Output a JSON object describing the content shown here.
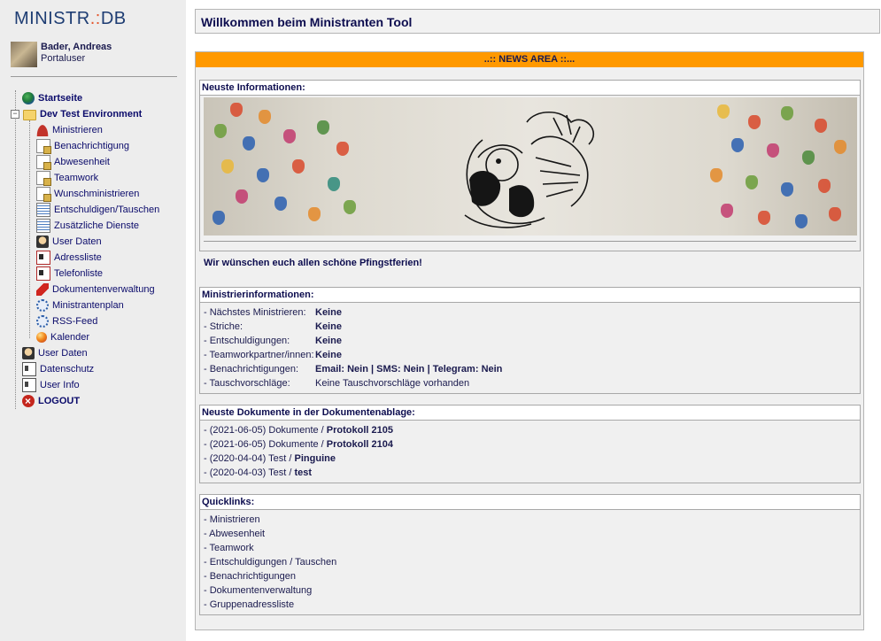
{
  "app": {
    "logo_main": "MINISTR",
    "logo_sep": ".:",
    "logo_end": "DB"
  },
  "user": {
    "name": "Bader, Andreas",
    "role": "Portaluser"
  },
  "nav": {
    "startseite": "Startseite",
    "group": "Dev Test Environment",
    "group_items": [
      "Ministrieren",
      "Benachrichtigung",
      "Abwesenheit",
      "Teamwork",
      "Wunschministrieren",
      "Entschuldigen/Tauschen",
      "Zusätzliche Dienste",
      "User Daten",
      "Adressliste",
      "Telefonliste",
      "Dokumentenverwaltung",
      "Ministrantenplan",
      "RSS-Feed",
      "Kalender"
    ],
    "bottom_items": [
      "User Daten",
      "Datenschutz",
      "User Info",
      "LOGOUT"
    ]
  },
  "page": {
    "title": "Willkommen beim Ministranten Tool",
    "news_header": "..:: NEWS AREA ::..."
  },
  "news": {
    "heading": "Neuste Informationen:",
    "text": "Wir wünschen euch allen schöne Pfingstferien!"
  },
  "info": {
    "heading": "Ministrierinformationen:",
    "rows": [
      {
        "label": "- Nächstes Ministrieren:",
        "value": "Keine"
      },
      {
        "label": "- Striche:",
        "value": "Keine"
      },
      {
        "label": "- Entschuldigungen:",
        "value": "Keine"
      },
      {
        "label": "- Teamworkpartner/innen:",
        "value": "Keine"
      }
    ],
    "notify_label": "- Benachrichtigungen:",
    "notify_email_label": "Email:",
    "notify_email": "Nein",
    "notify_sms_label": "SMS:",
    "notify_sms": "Nein",
    "notify_tg_label": "Telegram:",
    "notify_tg": "Nein",
    "swap_label": "- Tauschvorschläge:",
    "swap_value": "Keine Tauschvorschläge vorhanden"
  },
  "docs": {
    "heading": "Neuste Dokumente in der Dokumentenablage:",
    "items": [
      {
        "prefix": "- (2021-06-05) Dokumente / ",
        "name": "Protokoll 2105"
      },
      {
        "prefix": "- (2021-06-05) Dokumente / ",
        "name": "Protokoll 2104"
      },
      {
        "prefix": "- (2020-04-04) Test / ",
        "name": "Pinguine"
      },
      {
        "prefix": "- (2020-04-03) Test / ",
        "name": "test"
      }
    ]
  },
  "quicklinks": {
    "heading": "Quicklinks:",
    "items": [
      "- Ministrieren",
      "- Abwesenheit",
      "- Teamwork",
      "- Entschuldigungen / Tauschen",
      "- Benachrichtigungen",
      "- Dokumentenverwaltung",
      "- Gruppenadressliste"
    ]
  },
  "colors": {
    "accent_orange": "#ff9900",
    "text_navy": "#0d0d4f",
    "sidebar_bg": "#ededed"
  }
}
